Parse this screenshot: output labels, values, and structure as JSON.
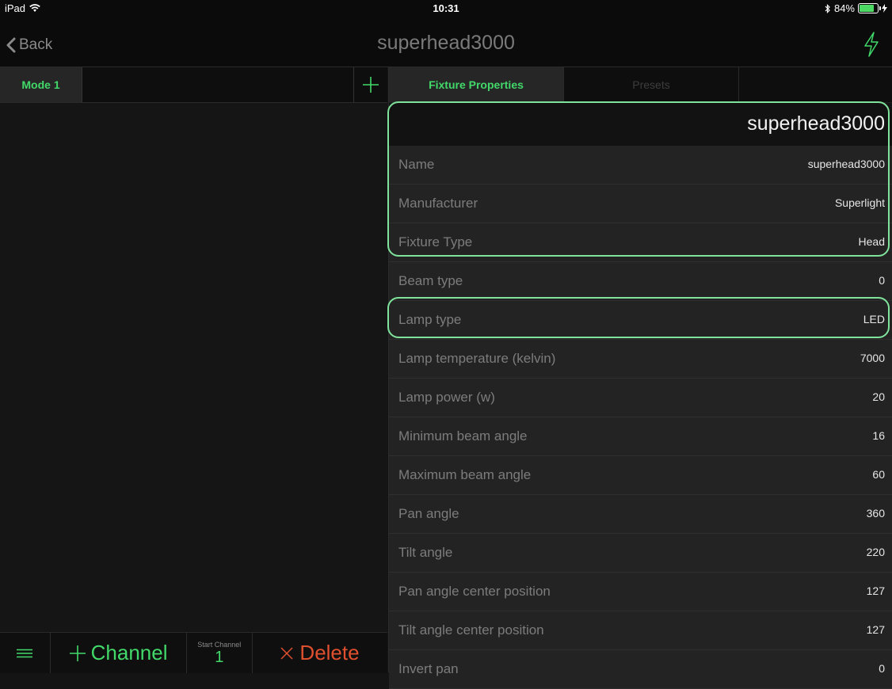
{
  "status_bar": {
    "device": "iPad",
    "time": "10:31",
    "battery_percent": "84%",
    "battery_level": 0.84
  },
  "nav": {
    "back_label": "Back",
    "title": "superhead3000",
    "action_icon": "lightning-icon"
  },
  "left_pane": {
    "mode_tab": "Mode 1",
    "bottom_bar": {
      "add_channel_label": "Channel",
      "start_channel_label": "Start Channel",
      "start_channel_value": "1",
      "delete_label": "Delete"
    }
  },
  "right_pane": {
    "tabs": [
      {
        "label": "Fixture Properties",
        "active": true
      },
      {
        "label": "Presets",
        "active": false
      }
    ],
    "header_name": "superhead3000",
    "properties": [
      {
        "label": "Name",
        "value": "superhead3000"
      },
      {
        "label": "Manufacturer",
        "value": "Superlight"
      },
      {
        "label": "Fixture Type",
        "value": "Head"
      },
      {
        "label": "Beam type",
        "value": "0"
      },
      {
        "label": "Lamp type",
        "value": "LED"
      },
      {
        "label": "Lamp temperature (kelvin)",
        "value": "7000"
      },
      {
        "label": "Lamp power (w)",
        "value": "20"
      },
      {
        "label": "Minimum beam angle",
        "value": "16"
      },
      {
        "label": "Maximum beam angle",
        "value": "60"
      },
      {
        "label": "Pan angle",
        "value": "360"
      },
      {
        "label": "Tilt angle",
        "value": "220"
      },
      {
        "label": "Pan angle center position",
        "value": "127"
      },
      {
        "label": "Tilt angle center position",
        "value": "127"
      },
      {
        "label": "Invert pan",
        "value": "0"
      }
    ]
  },
  "colors": {
    "accent": "#42d86a",
    "delete": "#e0502f",
    "highlight": "#7fe39b"
  }
}
